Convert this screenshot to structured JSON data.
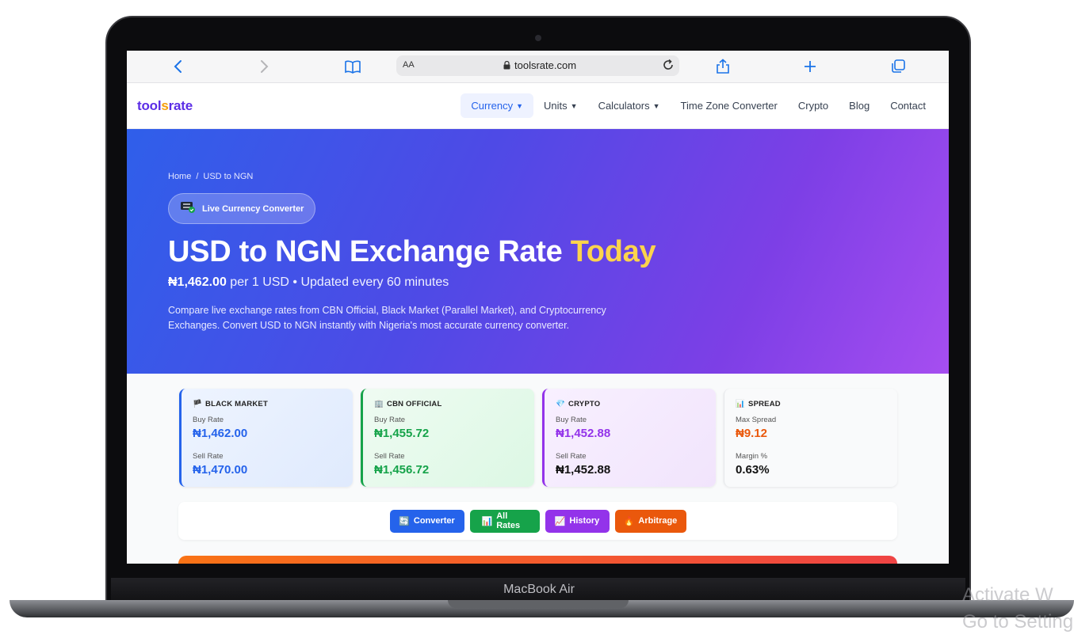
{
  "device": {
    "model_label": "MacBook Air"
  },
  "watermark": {
    "line1": "Activate W",
    "line2": "Go to Settings"
  },
  "browser": {
    "text_size_label": "AA",
    "url": "toolsrate.com"
  },
  "site": {
    "logo_part1": "tool",
    "logo_part2": "s",
    "logo_part3": "rate",
    "nav": [
      {
        "label": "Currency",
        "active": true
      },
      {
        "label": "Units"
      },
      {
        "label": "Calculators"
      },
      {
        "label": "Time Zone Converter"
      },
      {
        "label": "Crypto"
      },
      {
        "label": "Blog"
      },
      {
        "label": "Contact"
      }
    ]
  },
  "hero": {
    "breadcrumb": {
      "home": "Home",
      "separator": "/",
      "current": "USD to NGN"
    },
    "badge": "Live Currency Converter",
    "title_main": "USD to NGN Exchange Rate ",
    "title_highlight": "Today",
    "sub_rate": "₦1,462.00",
    "sub_rest": " per 1 USD • Updated every 60 minutes",
    "description": "Compare live exchange rates from CBN Official, Black Market (Parallel Market), and Cryptocurrency Exchanges. Convert USD to NGN instantly with Nigeria's most accurate currency converter."
  },
  "cards": [
    {
      "icon": "🏴",
      "title": "BLACK MARKET",
      "label1": "Buy Rate",
      "value1": "₦1,462.00",
      "label2": "Sell Rate",
      "value2": "₦1,470.00"
    },
    {
      "icon": "🏢",
      "title": "CBN OFFICIAL",
      "label1": "Buy Rate",
      "value1": "₦1,455.72",
      "label2": "Sell Rate",
      "value2": "₦1,456.72"
    },
    {
      "icon": "💎",
      "title": "CRYPTO",
      "label1": "Buy Rate",
      "value1": "₦1,452.88",
      "label2": "Sell Rate",
      "value2": "₦1,452.88"
    },
    {
      "icon": "📊",
      "title": "SPREAD",
      "label1": "Max Spread",
      "value1": "₦9.12",
      "label2": "Margin %",
      "value2": "0.63%"
    }
  ],
  "tabs": [
    {
      "icon": "🔄",
      "label": "Converter"
    },
    {
      "icon": "📊",
      "label": "All Rates"
    },
    {
      "icon": "📈",
      "label": "History"
    },
    {
      "icon": "🔥",
      "label": "Arbitrage"
    }
  ],
  "colors": {
    "accent_blue": "#2563eb",
    "accent_green": "#16a34a",
    "accent_purple": "#9333ea",
    "accent_orange": "#ea580c",
    "highlight_yellow": "#fcd34d"
  }
}
